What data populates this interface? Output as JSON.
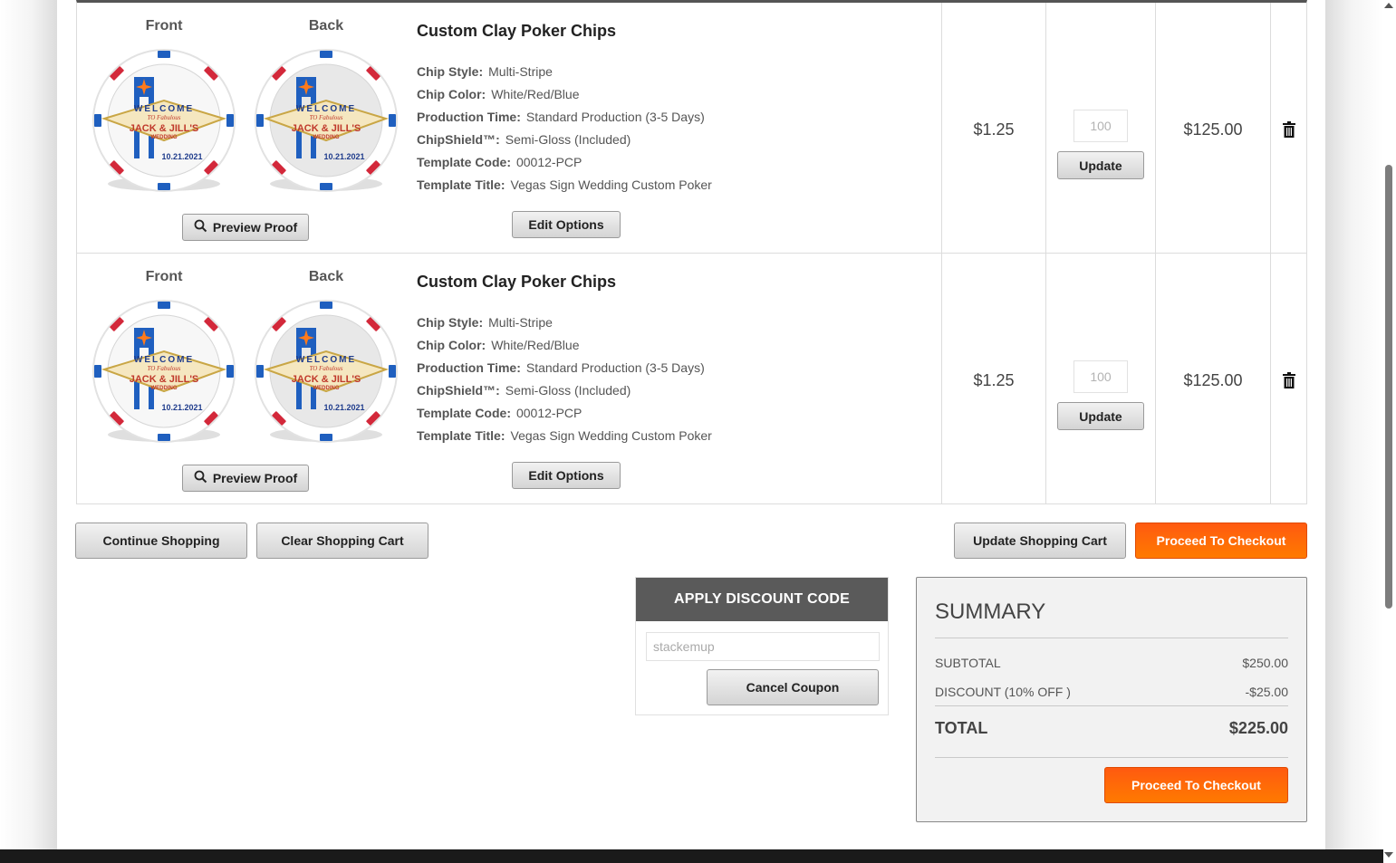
{
  "colors": {
    "accent_orange": "#ff6a00",
    "chip_red": "#d3283a",
    "chip_blue": "#1f5fbf",
    "discount_header": "#5a5a5a"
  },
  "cart": {
    "items": [
      {
        "front_label": "Front",
        "back_label": "Back",
        "chip_art": {
          "line1": "WELCOME",
          "line2": "TO Fabulous",
          "line3": "JACK & JILL'S",
          "line4": "WEDDING",
          "date": "10.21.2021"
        },
        "preview_label": "Preview Proof",
        "title": "Custom Clay Poker Chips",
        "specs": [
          {
            "key": "Chip Style:",
            "value": "Multi-Stripe"
          },
          {
            "key": "Chip Color:",
            "value": "White/Red/Blue"
          },
          {
            "key": "Production Time:",
            "value": "Standard Production (3-5 Days)"
          },
          {
            "key": "ChipShield™:",
            "value": "Semi-Gloss (Included)"
          },
          {
            "key": "Template Code:",
            "value": "00012-PCP"
          },
          {
            "key": "Template Title:",
            "value": "Vegas Sign Wedding Custom Poker"
          }
        ],
        "edit_label": "Edit Options",
        "unit_price": "$1.25",
        "quantity": "100",
        "update_label": "Update",
        "subtotal": "$125.00",
        "remove_icon": "trash-icon"
      },
      {
        "front_label": "Front",
        "back_label": "Back",
        "chip_art": {
          "line1": "WELCOME",
          "line2": "TO Fabulous",
          "line3": "JACK & JILL'S",
          "line4": "WEDDING",
          "date": "10.21.2021"
        },
        "preview_label": "Preview Proof",
        "title": "Custom Clay Poker Chips",
        "specs": [
          {
            "key": "Chip Style:",
            "value": "Multi-Stripe"
          },
          {
            "key": "Chip Color:",
            "value": "White/Red/Blue"
          },
          {
            "key": "Production Time:",
            "value": "Standard Production (3-5 Days)"
          },
          {
            "key": "ChipShield™:",
            "value": "Semi-Gloss (Included)"
          },
          {
            "key": "Template Code:",
            "value": "00012-PCP"
          },
          {
            "key": "Template Title:",
            "value": "Vegas Sign Wedding Custom Poker"
          }
        ],
        "edit_label": "Edit Options",
        "unit_price": "$1.25",
        "quantity": "100",
        "update_label": "Update",
        "subtotal": "$125.00",
        "remove_icon": "trash-icon"
      }
    ]
  },
  "actions": {
    "continue_shopping": "Continue Shopping",
    "clear_cart": "Clear Shopping Cart",
    "update_cart": "Update Shopping Cart",
    "checkout": "Proceed To Checkout"
  },
  "discount": {
    "header": "APPLY DISCOUNT CODE",
    "code_value": "stackemup",
    "cancel_label": "Cancel Coupon"
  },
  "summary": {
    "title": "SUMMARY",
    "subtotal_label": "SUBTOTAL",
    "subtotal_value": "$250.00",
    "discount_label": "DISCOUNT (10% OFF )",
    "discount_value": "-$25.00",
    "total_label": "TOTAL",
    "total_value": "$225.00",
    "checkout_label": "Proceed To Checkout"
  }
}
